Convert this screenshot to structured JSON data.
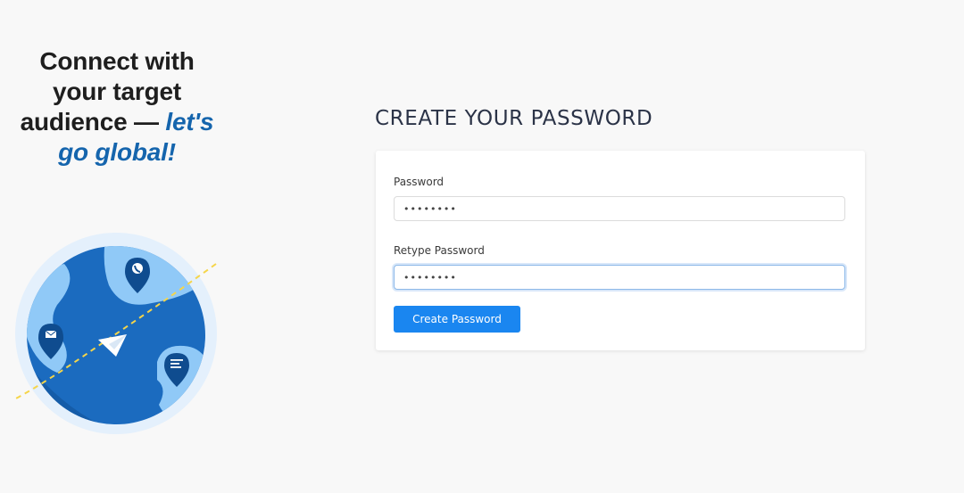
{
  "promo": {
    "line1": "Connect with",
    "line2": "your target",
    "line3_prefix": "audience — ",
    "line3_accent": "let's",
    "line4_accent": "go global!",
    "accent_color": "#1565ad",
    "illustration": {
      "name": "globe-illustration",
      "icons": [
        "phone-pin-icon",
        "mail-pin-icon",
        "message-pin-icon",
        "paper-plane-icon"
      ]
    }
  },
  "form": {
    "title": "CREATE YOUR PASSWORD",
    "password_label": "Password",
    "password_value": "••••••••",
    "retype_label": "Retype Password",
    "retype_value": "••••••••",
    "submit_label": "Create Password",
    "button_color": "#1a86f0"
  }
}
